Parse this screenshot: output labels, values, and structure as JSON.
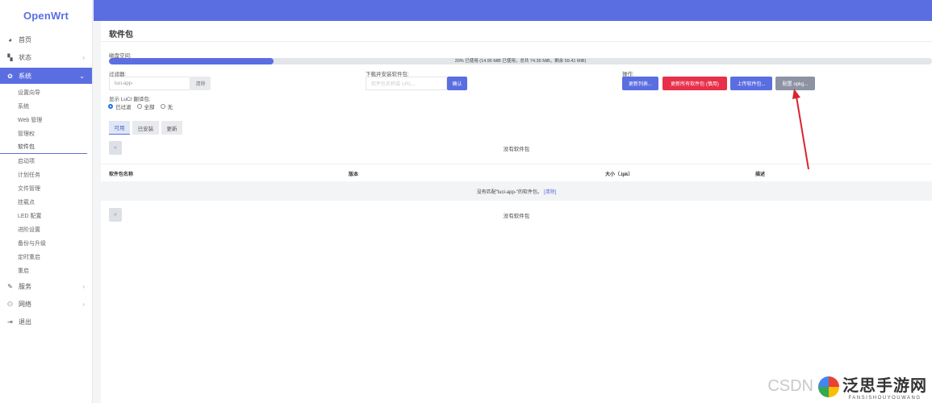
{
  "sidebar": {
    "logo": "OpenWrt",
    "items": [
      {
        "label": "首页",
        "icon": "palette-icon"
      },
      {
        "label": "状态",
        "icon": "dashboard-icon"
      },
      {
        "label": "系统",
        "icon": "gear-icon"
      },
      {
        "label": "服务",
        "icon": "services-icon"
      },
      {
        "label": "网络",
        "icon": "network-icon"
      },
      {
        "label": "退出",
        "icon": "logout-icon"
      }
    ],
    "submenu": [
      "设置向导",
      "系统",
      "Web 管理",
      "管理权",
      "软件包",
      "启动项",
      "计划任务",
      "文件管理",
      "挂载点",
      "LED 配置",
      "进阶设置",
      "备份与升级",
      "定时重启",
      "重启"
    ]
  },
  "page": {
    "title": "软件包",
    "disk_label": "磁盘空间:",
    "disk_text": "20% 已使用 (14.95 MiB 已使用，总共 74.36 MiB，剩余 59.41 MiB)",
    "disk_percent": 20,
    "filter_label": "过滤器:",
    "filter_value": "luci-app-",
    "clear_button": "清除",
    "download_label": "下载并安装软件包:",
    "download_placeholder": "软件包名称或 URL...",
    "ok_button": "确认",
    "actions_label": "操作:",
    "update_lists_button": "更新列表...",
    "upgrade_all_button": "更新所有软件包 (慎用)",
    "upload_button": "上传软件包...",
    "configure_button": "配置 opkg...",
    "translation_label": "显示 LuCI 翻译包:",
    "radio_options": [
      "已过滤",
      "全部",
      "无"
    ],
    "tabs": [
      "可用",
      "已安装",
      "更新"
    ],
    "pager_symbol": "«",
    "no_packages": "没有软件包",
    "columns": [
      "软件包名称",
      "版本",
      "大小（.ipk）",
      "描述"
    ],
    "no_match_text": "没有匹配\"luci-app-\"的软件包。",
    "no_match_link": "[清除]"
  },
  "watermark": {
    "csdn": "CSDN",
    "brand_cn": "泛思手游网",
    "brand_en": "FANSISHOUYOUWANG"
  },
  "colors": {
    "accent": "#5b6ee1",
    "danger": "#e8304a",
    "annotation": "#d9232e"
  }
}
